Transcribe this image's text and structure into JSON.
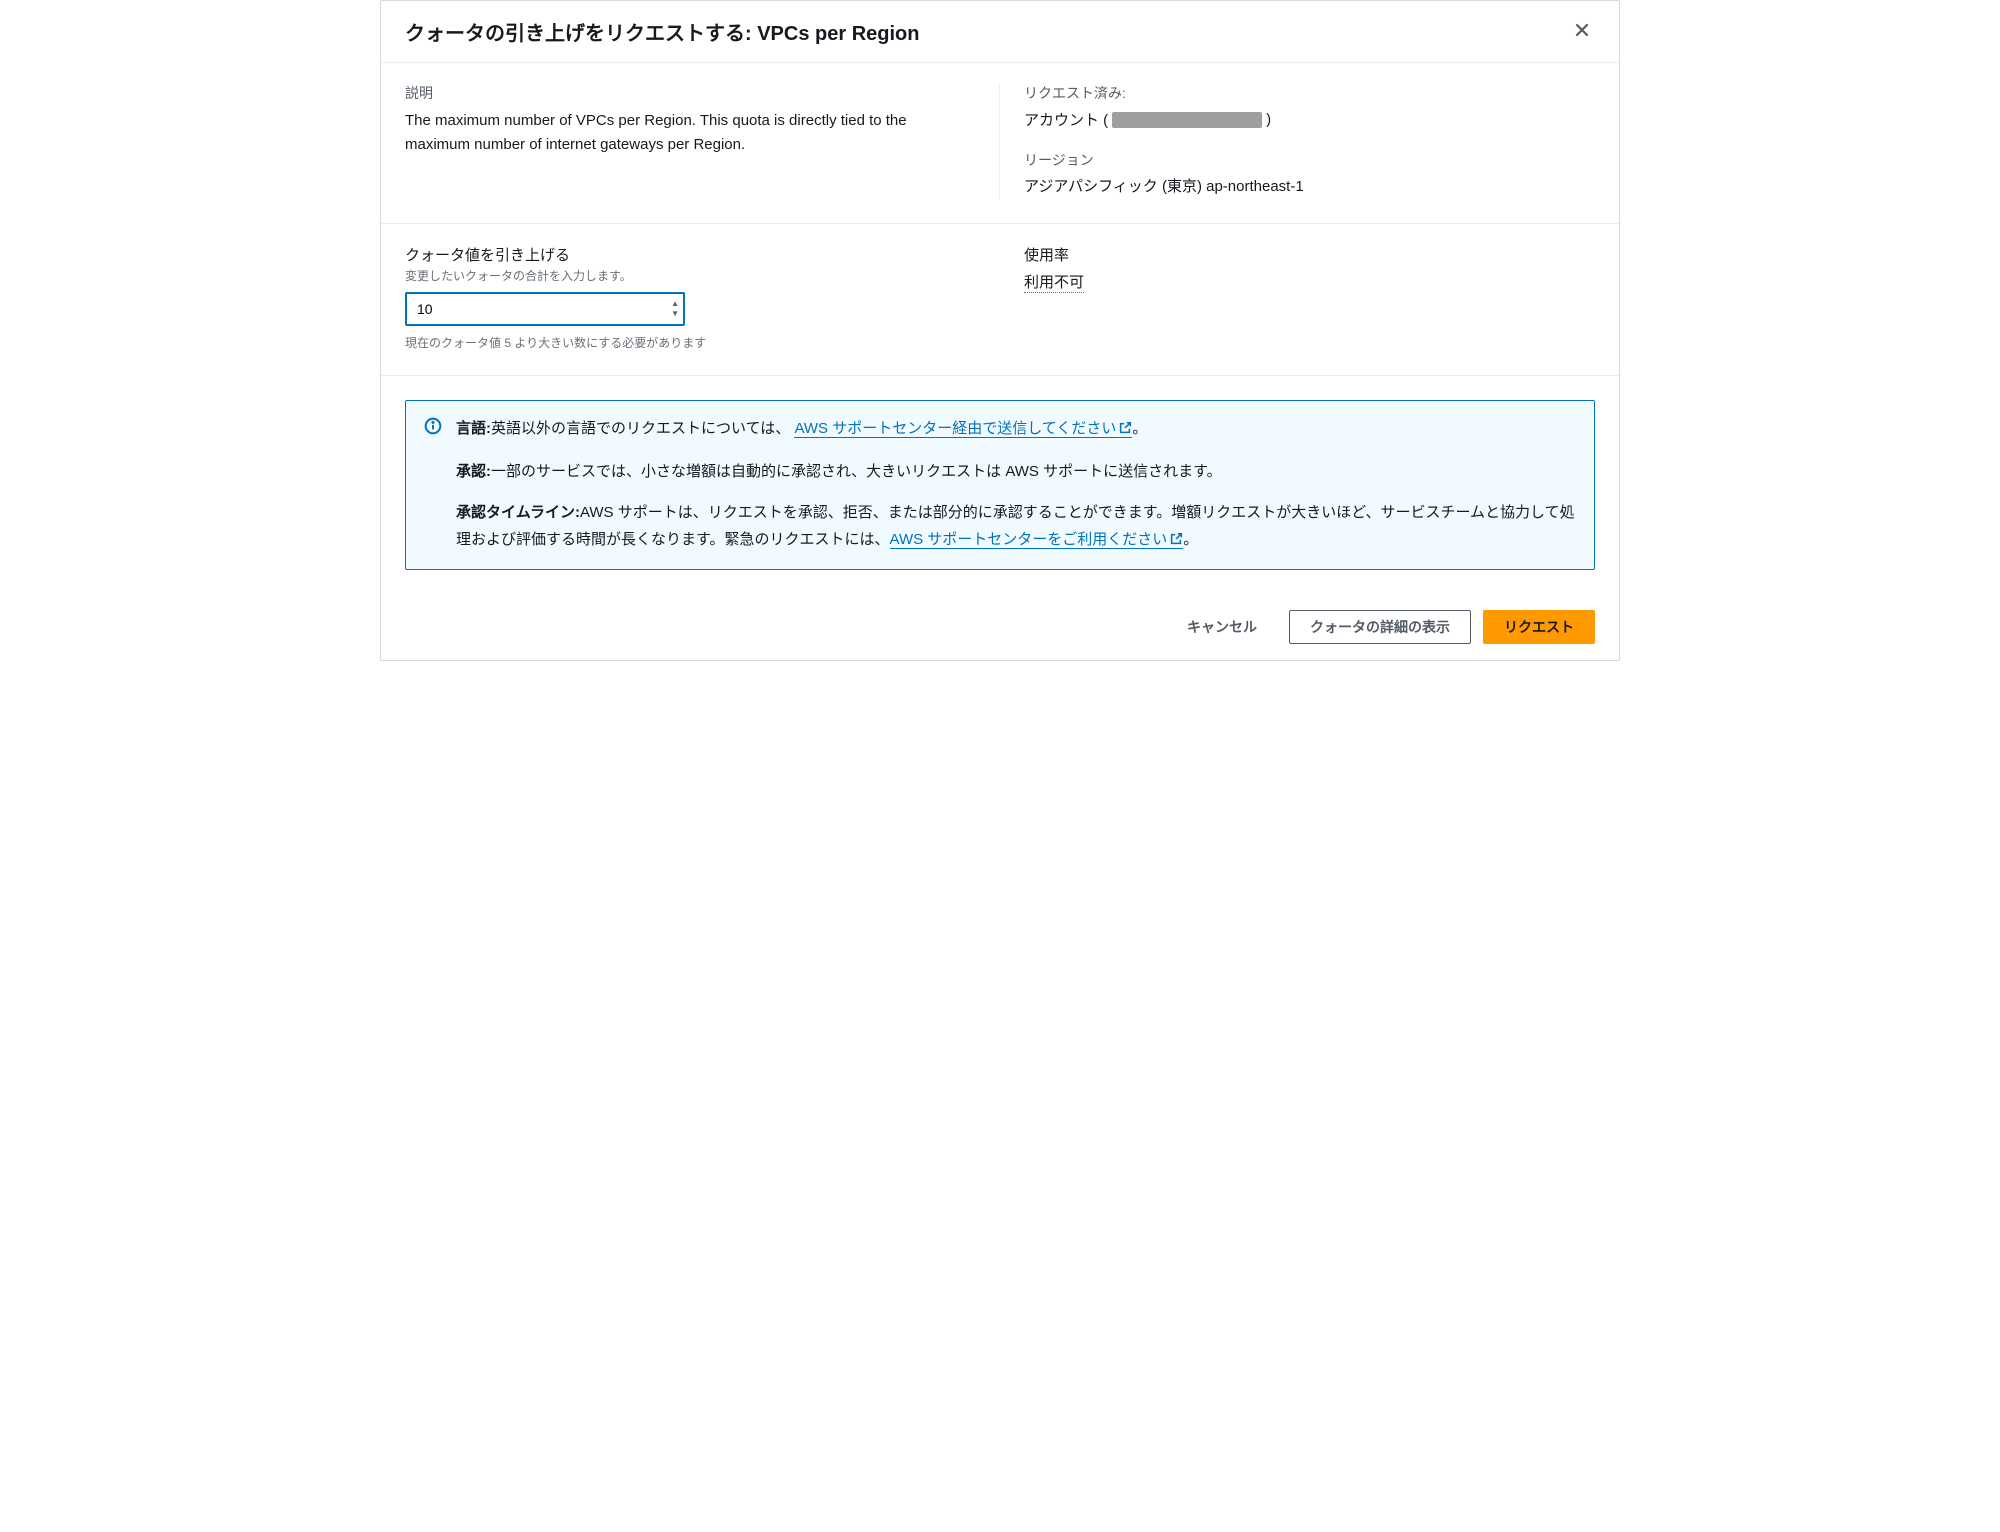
{
  "header": {
    "title": "クォータの引き上げをリクエストする: VPCs per Region"
  },
  "info": {
    "description_label": "説明",
    "description_text": "The maximum number of VPCs per Region. This quota is directly tied to the maximum number of internet gateways per Region.",
    "requested_label": "リクエスト済み:",
    "account_label": "アカウント (",
    "account_close": ")",
    "region_label": "リージョン",
    "region_value": "アジアパシフィック (東京) ap-northeast-1"
  },
  "quota": {
    "input_label": "クォータ値を引き上げる",
    "input_hint": "変更したいクォータの合計を入力します。",
    "input_value": "10",
    "input_help": "現在のクォータ値 5 より大きい数にする必要があります",
    "usage_label": "使用率",
    "usage_value": "利用不可"
  },
  "notice": {
    "lang_label": "言語:",
    "lang_text": "英語以外の言語でのリクエストについては、",
    "lang_link": "AWS サポートセンター経由で送信してください",
    "lang_after": "。",
    "approval_label": "承認:",
    "approval_text": "一部のサービスでは、小さな増額は自動的に承認され、大きいリクエストは AWS サポートに送信されます。",
    "timeline_label": "承認タイムライン:",
    "timeline_text": "AWS サポートは、リクエストを承認、拒否、または部分的に承認することができます。増額リクエストが大きいほど、サービスチームと協力して処理および評価する時間が長くなります。緊急のリクエストには、",
    "timeline_link": "AWS サポートセンターをご利用ください",
    "timeline_after": "。"
  },
  "footer": {
    "cancel": "キャンセル",
    "details": "クォータの詳細の表示",
    "request": "リクエスト"
  }
}
